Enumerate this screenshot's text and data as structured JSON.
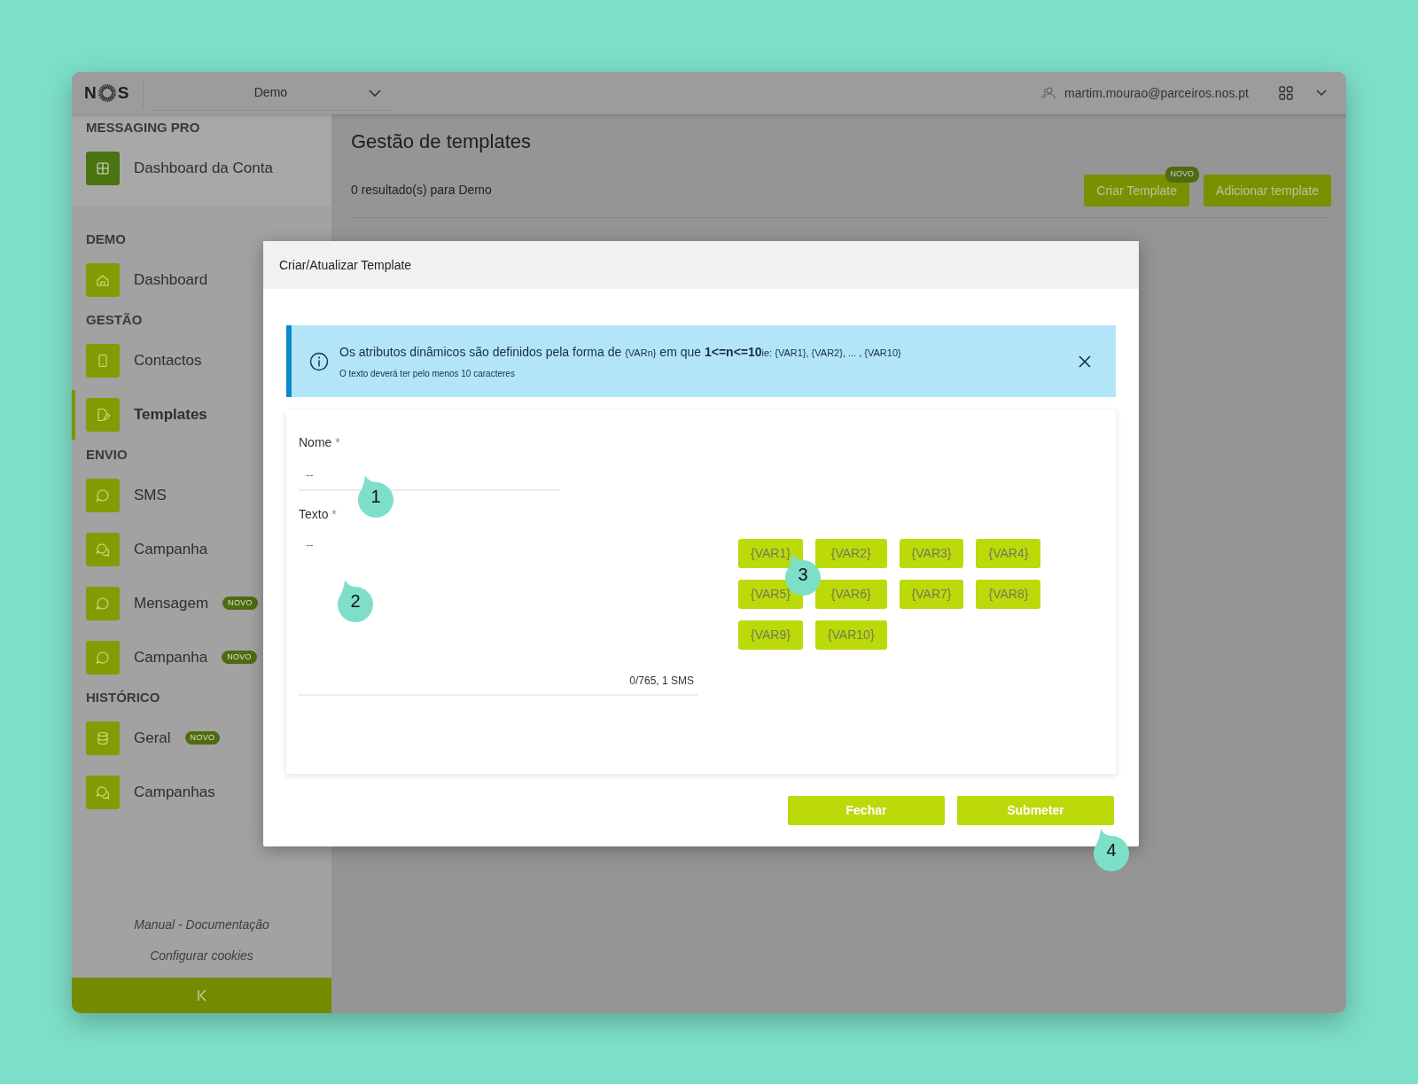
{
  "topbar": {
    "logo_left": "N",
    "logo_right": "S",
    "account_select": "Demo",
    "user": "martim.mourao@parceiros.nos.pt"
  },
  "sidebar": {
    "title": "MESSAGING PRO",
    "top_items": [
      {
        "label": "Dashboard da Conta",
        "kind": "grid",
        "selected": false
      }
    ],
    "sections": [
      {
        "title": "DEMO",
        "items": [
          {
            "label": "Dashboard",
            "kind": "home",
            "selected": false
          }
        ]
      },
      {
        "title": "GESTÃO",
        "items": [
          {
            "label": "Contactos",
            "kind": "phone",
            "selected": false
          },
          {
            "label": "Templates",
            "kind": "edit",
            "selected": true
          }
        ]
      },
      {
        "title": "ENVIO",
        "items": [
          {
            "label": "SMS",
            "kind": "chat",
            "selected": false
          },
          {
            "label": "Campanha",
            "kind": "chats",
            "selected": false
          },
          {
            "label": "Mensagem",
            "kind": "chat",
            "selected": false,
            "badge": "NOVO"
          },
          {
            "label": "Campanha",
            "kind": "chat",
            "selected": false,
            "badge": "NOVO"
          }
        ]
      },
      {
        "title": "HISTÓRICO",
        "items": [
          {
            "label": "Geral",
            "kind": "database",
            "selected": false,
            "badge": "NOVO"
          },
          {
            "label": "Campanhas",
            "kind": "chats",
            "selected": false
          }
        ]
      }
    ],
    "links": [
      "Manual - Documentação",
      "Configurar cookies"
    ]
  },
  "main": {
    "title": "Gestão de templates",
    "results": "0 resultado(s) para Demo",
    "buttons": [
      {
        "label": "Criar Template",
        "badge": "NOVO"
      },
      {
        "label": "Adicionar template"
      }
    ]
  },
  "modal": {
    "title": "Criar/Atualizar Template",
    "alert": {
      "parts": [
        {
          "kind": "text",
          "text": "Os atributos dinâmicos são definidos pela forma de "
        },
        {
          "kind": "small",
          "text": "{VARn}"
        },
        {
          "kind": "text",
          "text": " em que "
        },
        {
          "kind": "bold",
          "text": "1<=n<=10"
        },
        {
          "kind": "small",
          "text": "ie: {VAR1}, {VAR2}, ... , {VAR10}"
        }
      ],
      "note": "O texto deverá ter pelo menos 10 caracteres"
    },
    "fields": [
      {
        "kind": "input",
        "label": "Nome",
        "mark": "*",
        "placeholder": "--"
      },
      {
        "kind": "textarea",
        "label": "Texto",
        "mark": "*",
        "placeholder": "--",
        "counter": "0/765, 1 SMS"
      }
    ],
    "variables": [
      "{VAR1}",
      "{VAR2}",
      "{VAR3}",
      "{VAR4}",
      "{VAR5}",
      "{VAR6}",
      "{VAR7}",
      "{VAR8}",
      "{VAR9}",
      "{VAR10}"
    ],
    "buttons": [
      "Fechar",
      "Submeter"
    ]
  },
  "callouts": [
    "1",
    "2",
    "3",
    "4"
  ]
}
